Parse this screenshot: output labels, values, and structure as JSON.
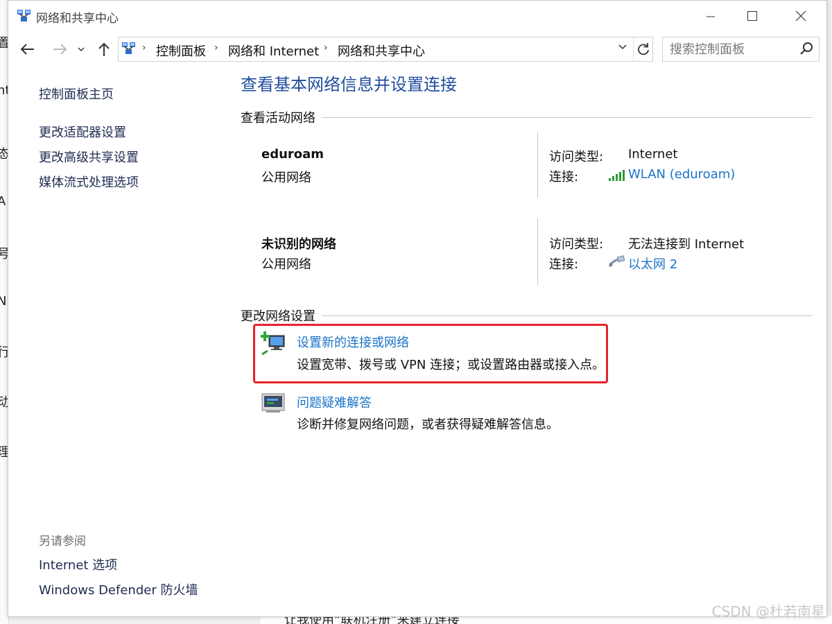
{
  "window": {
    "title": "网络和共享中心"
  },
  "address_bar": {
    "crumbs": [
      "控制面板",
      "网络和 Internet",
      "网络和共享中心"
    ]
  },
  "search": {
    "placeholder": "搜索控制面板"
  },
  "sidebar": {
    "home": "控制面板主页",
    "links": [
      "更改适配器设置",
      "更改高级共享设置",
      "媒体流式处理选项"
    ],
    "see_also_heading": "另请参阅",
    "see_also": [
      "Internet 选项",
      "Windows Defender 防火墙"
    ]
  },
  "main": {
    "title": "查看基本网络信息并设置连接",
    "active_networks_header": "查看活动网络",
    "networks": [
      {
        "name": "eduroam",
        "category": "公用网络",
        "access_label": "访问类型:",
        "access_value": "Internet",
        "conn_label": "连接:",
        "conn_value": "WLAN (eduroam)",
        "conn_icon": "wifi-signal-icon"
      },
      {
        "name": "未识别的网络",
        "category": "公用网络",
        "access_label": "访问类型:",
        "access_value": "无法连接到 Internet",
        "conn_label": "连接:",
        "conn_value": "以太网 2",
        "conn_icon": "ethernet-cable-icon"
      }
    ],
    "change_settings_header": "更改网络设置",
    "tasks": [
      {
        "title": "设置新的连接或网络",
        "desc": "设置宽带、拨号或 VPN 连接；或设置路由器或接入点。",
        "icon": "new-connection-icon"
      },
      {
        "title": "问题疑难解答",
        "desc": "诊断并修复网络问题，或者获得疑难解答信息。",
        "icon": "troubleshoot-icon"
      }
    ]
  },
  "background": {
    "bottom_text": "让我使用“联机注册”来建立连接",
    "left_fragments": [
      "置",
      "nt",
      "态",
      "A",
      "号",
      "N",
      "行",
      "动",
      "理"
    ]
  },
  "watermark": "CSDN @杜若南星",
  "colors": {
    "link": "#1a73c8",
    "title": "#1f4e9e",
    "highlight": "#e8212a"
  }
}
